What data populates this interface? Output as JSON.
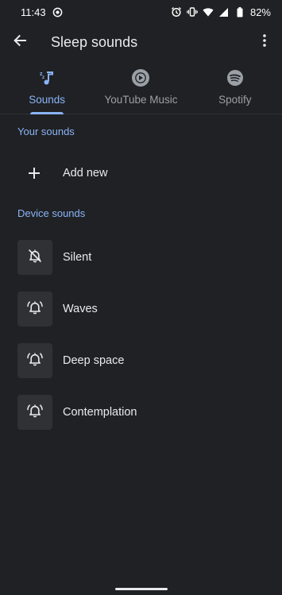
{
  "status_bar": {
    "time": "11:43",
    "battery": "82%"
  },
  "app_bar": {
    "title": "Sleep sounds",
    "back_icon": "arrow-back-icon",
    "more_icon": "more-vert-icon"
  },
  "tabs": [
    {
      "label": "Sounds",
      "icon": "music-note-sleep-icon",
      "active": true
    },
    {
      "label": "YouTube Music",
      "icon": "youtube-music-icon",
      "active": false
    },
    {
      "label": "Spotify",
      "icon": "spotify-icon",
      "active": false
    }
  ],
  "your_sounds": {
    "header": "Your sounds",
    "add_label": "Add new"
  },
  "device_sounds": {
    "header": "Device sounds",
    "items": [
      {
        "label": "Silent",
        "icon": "alarm-off-icon"
      },
      {
        "label": "Waves",
        "icon": "alarm-bell-icon"
      },
      {
        "label": "Deep space",
        "icon": "alarm-bell-icon"
      },
      {
        "label": "Contemplation",
        "icon": "alarm-bell-icon"
      }
    ]
  },
  "colors": {
    "background": "#202124",
    "accent": "#8ab4f8",
    "tile": "#303134",
    "text": "#e8eaed",
    "secondary_text": "#9aa0a6"
  }
}
